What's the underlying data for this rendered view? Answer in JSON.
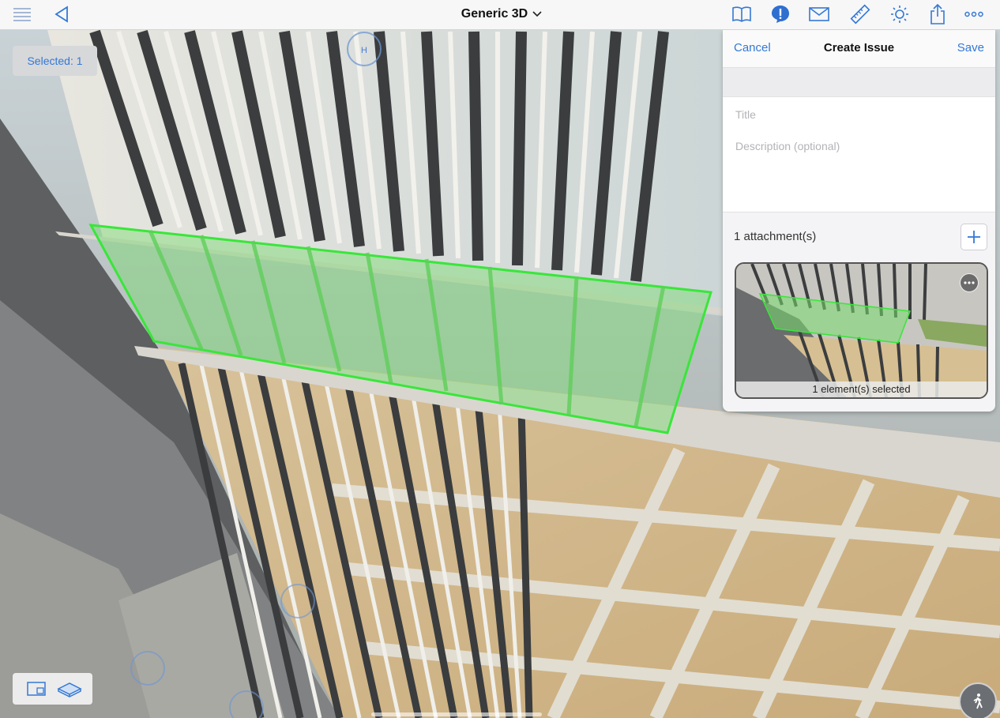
{
  "header": {
    "title": "Generic 3D",
    "icons": [
      "list-icon",
      "back-icon",
      "book-icon",
      "issue-icon",
      "mail-icon",
      "ruler-icon",
      "sun-icon",
      "share-icon",
      "more-icon"
    ],
    "accent": "#3478d6"
  },
  "viewer": {
    "selected_label": "Selected: 1",
    "nav_marker": "H",
    "selection_color": "#39e63a"
  },
  "issue_panel": {
    "cancel_label": "Cancel",
    "title": "Create Issue",
    "save_label": "Save",
    "title_placeholder": "Title",
    "description_placeholder": "Description (optional)",
    "attachments_label": "1 attachment(s)",
    "thumbnail_caption": "1 element(s) selected"
  },
  "bottom_toolbar": {
    "icons": [
      "sheet-view-icon",
      "3d-box-icon",
      "walk-icon"
    ]
  }
}
